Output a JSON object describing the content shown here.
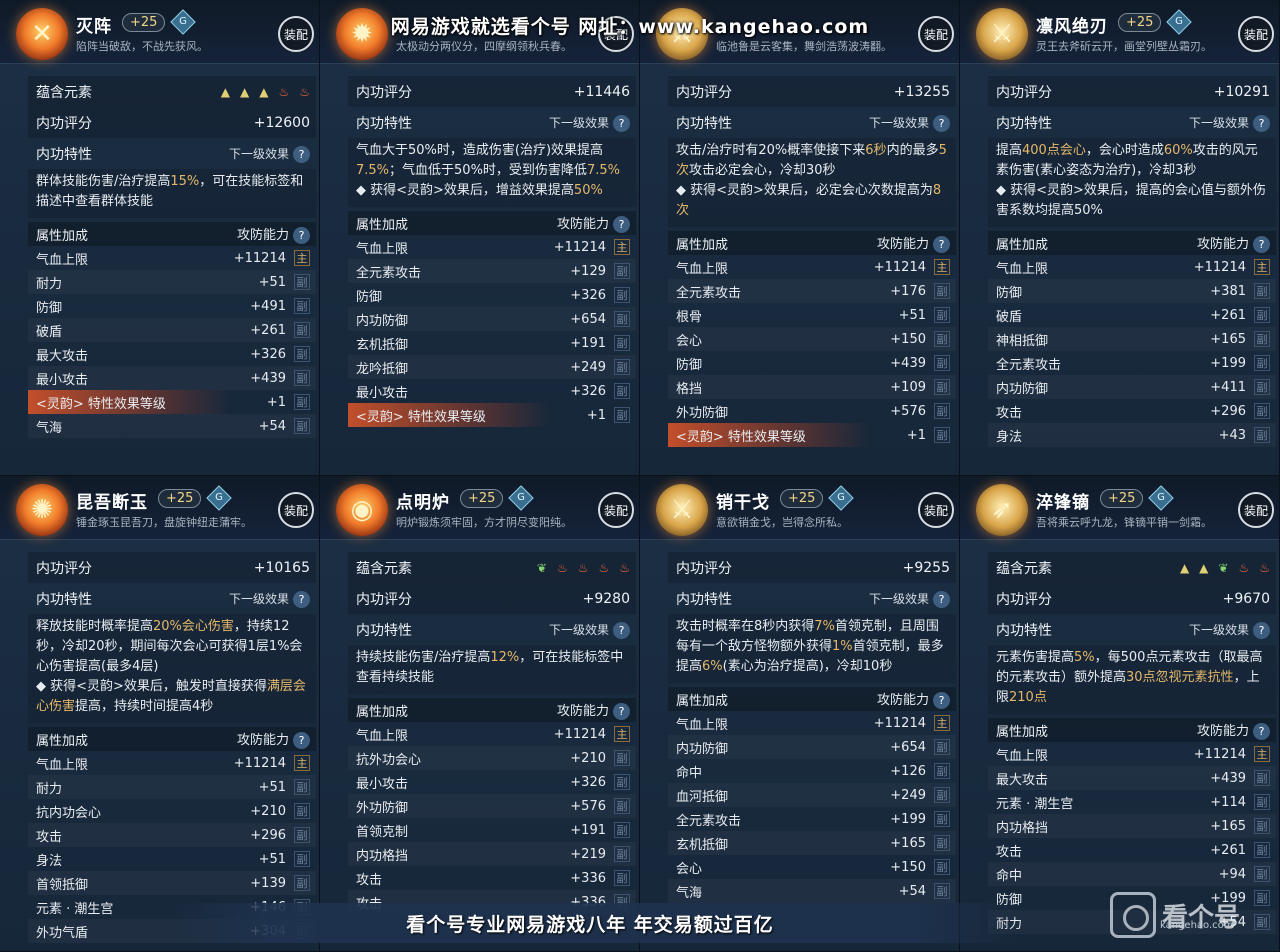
{
  "banner": "网易游戏就选看个号   网址：www.kangehao.com",
  "footer": "看个号专业网易游戏八年  年交易额过百亿",
  "watermark": {
    "brand": "看个号",
    "domain": "kangehao.com"
  },
  "common": {
    "equip": "装配",
    "next_effect": "下一级效果",
    "attr_header": "属性加成",
    "atk_def": "攻防能力",
    "q": "?",
    "main_tag": "主",
    "sub_tag": "副"
  },
  "cards": [
    {
      "name": "灭阵",
      "level": "+25",
      "grade": "G",
      "desc": "陷阵当破敌，不战先获风。",
      "icon": "flame-x-icon",
      "icon_style": "fire",
      "element_label": "蕴含元素",
      "elements": [
        {
          "kind": "earth",
          "glyph": "▲"
        },
        {
          "kind": "earth",
          "glyph": "▲"
        },
        {
          "kind": "earth",
          "glyph": "▲"
        },
        {
          "kind": "fire",
          "glyph": "♨"
        },
        {
          "kind": "fire",
          "glyph": "♨"
        }
      ],
      "score_label": "内功评分",
      "score": "+12600",
      "trait_label": "内功特性",
      "trait": [
        "群体技能伤害/治疗提高",
        "15%",
        "，可在技能标签和描述中查看群体技能"
      ],
      "attrs": [
        {
          "n": "气血上限",
          "v": "+11214",
          "t": "main"
        },
        {
          "n": "耐力",
          "v": "+51",
          "t": "sub"
        },
        {
          "n": "防御",
          "v": "+491",
          "t": "sub"
        },
        {
          "n": "破盾",
          "v": "+261",
          "t": "sub"
        },
        {
          "n": "最大攻击",
          "v": "+326",
          "t": "sub"
        },
        {
          "n": "最小攻击",
          "v": "+439",
          "t": "sub"
        },
        {
          "n": "<灵韵> 特性效果等级",
          "v": "+1",
          "t": "sub",
          "special": true
        },
        {
          "n": "气海",
          "v": "+54",
          "t": "sub"
        }
      ]
    },
    {
      "name": "",
      "level": "",
      "grade": "",
      "desc": "太极动分两仪分，四摩纲领秋兵春。",
      "icon": "flame-icon",
      "icon_style": "fire",
      "score_label": "内功评分",
      "score": "+11446",
      "trait_label": "内功特性",
      "trait": [
        "气血大于50%时，造成伤害(治疗)效果提高",
        "7.5%",
        "；气血低于50%时，受到伤害降低",
        "7.5%",
        "\n◆ 获得<灵韵>效果后，增益效果提高",
        "50%"
      ],
      "attrs": [
        {
          "n": "气血上限",
          "v": "+11214",
          "t": "main"
        },
        {
          "n": "全元素攻击",
          "v": "+129",
          "t": "sub"
        },
        {
          "n": "防御",
          "v": "+326",
          "t": "sub"
        },
        {
          "n": "内功防御",
          "v": "+654",
          "t": "sub"
        },
        {
          "n": "玄机抵御",
          "v": "+191",
          "t": "sub"
        },
        {
          "n": "龙吟抵御",
          "v": "+249",
          "t": "sub"
        },
        {
          "n": "最小攻击",
          "v": "+326",
          "t": "sub"
        },
        {
          "n": "<灵韵> 特性效果等级",
          "v": "+1",
          "t": "sub",
          "special": true
        }
      ]
    },
    {
      "name": "",
      "level": "",
      "grade": "",
      "desc": "临池鲁是云客集，舞剑浩荡波涛翻。",
      "icon": "blade-icon",
      "icon_style": "gold",
      "score_label": "内功评分",
      "score": "+13255",
      "trait_label": "内功特性",
      "trait": [
        "攻击/治疗时有20%概率使接下来",
        "6秒",
        "内的最多",
        "5次",
        "攻击必定会心，冷却30秒\n◆ 获得<灵韵>效果后，必定会心次数提高为",
        "8次"
      ],
      "attrs": [
        {
          "n": "气血上限",
          "v": "+11214",
          "t": "main"
        },
        {
          "n": "全元素攻击",
          "v": "+176",
          "t": "sub"
        },
        {
          "n": "根骨",
          "v": "+51",
          "t": "sub"
        },
        {
          "n": "会心",
          "v": "+150",
          "t": "sub"
        },
        {
          "n": "防御",
          "v": "+439",
          "t": "sub"
        },
        {
          "n": "格挡",
          "v": "+109",
          "t": "sub"
        },
        {
          "n": "外功防御",
          "v": "+576",
          "t": "sub"
        },
        {
          "n": "<灵韵> 特性效果等级",
          "v": "+1",
          "t": "sub",
          "special": true
        }
      ]
    },
    {
      "name": "凛风绝刃",
      "level": "+25",
      "grade": "G",
      "desc": "灵王去斧斫云开，画堂列壁丛霜刃。",
      "icon": "wind-blade-icon",
      "icon_style": "gold",
      "score_label": "内功评分",
      "score": "+10291",
      "trait_label": "内功特性",
      "trait": [
        "提高",
        "400点会心",
        "，会心时造成",
        "60%",
        "攻击的风元素伤害(素心姿态为治疗)，冷却3秒\n◆ 获得<灵韵>效果后，提高的会心值与额外伤害系数均提高50%"
      ],
      "attrs": [
        {
          "n": "气血上限",
          "v": "+11214",
          "t": "main"
        },
        {
          "n": "防御",
          "v": "+381",
          "t": "sub"
        },
        {
          "n": "破盾",
          "v": "+261",
          "t": "sub"
        },
        {
          "n": "神相抵御",
          "v": "+165",
          "t": "sub"
        },
        {
          "n": "全元素攻击",
          "v": "+199",
          "t": "sub"
        },
        {
          "n": "内功防御",
          "v": "+411",
          "t": "sub"
        },
        {
          "n": "攻击",
          "v": "+296",
          "t": "sub"
        },
        {
          "n": "身法",
          "v": "+43",
          "t": "sub"
        }
      ]
    },
    {
      "name": "昆吾断玉",
      "level": "+25",
      "grade": "G",
      "desc": "锤金琢玉昆吾刀，盘旋钟纽走蒲牢。",
      "icon": "flame-feather-icon",
      "icon_style": "fire",
      "score_label": "内功评分",
      "score": "+10165",
      "trait_label": "内功特性",
      "trait": [
        "释放技能时概率提高",
        "20%会心伤害",
        "，持续12秒，冷却20秒，期间每次会心可获得1层1%会心伤害提高(最多4层)\n◆ 获得<灵韵>效果后，触发时直接获得",
        "满层会心伤害",
        "提高，持续时间提高4秒"
      ],
      "attrs": [
        {
          "n": "气血上限",
          "v": "+11214",
          "t": "main"
        },
        {
          "n": "耐力",
          "v": "+51",
          "t": "sub"
        },
        {
          "n": "抗内功会心",
          "v": "+210",
          "t": "sub"
        },
        {
          "n": "攻击",
          "v": "+296",
          "t": "sub"
        },
        {
          "n": "身法",
          "v": "+51",
          "t": "sub"
        },
        {
          "n": "首领抵御",
          "v": "+139",
          "t": "sub"
        },
        {
          "n": "元素 · 潮生宫",
          "v": "+146",
          "t": "sub"
        },
        {
          "n": "外功气盾",
          "v": "+304",
          "t": "sub"
        }
      ]
    },
    {
      "name": "点明炉",
      "level": "+25",
      "grade": "G",
      "desc": "明炉锻炼须牢固，方才阴尽变阳纯。",
      "icon": "fire-ring-icon",
      "icon_style": "fire",
      "element_label": "蕴含元素",
      "elements": [
        {
          "kind": "wood",
          "glyph": "❦"
        },
        {
          "kind": "fire",
          "glyph": "♨"
        },
        {
          "kind": "fire",
          "glyph": "♨"
        },
        {
          "kind": "fire",
          "glyph": "♨"
        },
        {
          "kind": "fire",
          "glyph": "♨"
        }
      ],
      "score_label": "内功评分",
      "score": "+9280",
      "trait_label": "内功特性",
      "trait": [
        "持续技能伤害/治疗提高",
        "12%",
        "，可在技能标签中查看持续技能"
      ],
      "attrs": [
        {
          "n": "气血上限",
          "v": "+11214",
          "t": "main"
        },
        {
          "n": "抗外功会心",
          "v": "+210",
          "t": "sub"
        },
        {
          "n": "最小攻击",
          "v": "+326",
          "t": "sub"
        },
        {
          "n": "外功防御",
          "v": "+576",
          "t": "sub"
        },
        {
          "n": "首领克制",
          "v": "+191",
          "t": "sub"
        },
        {
          "n": "内功格挡",
          "v": "+219",
          "t": "sub"
        },
        {
          "n": "攻击",
          "v": "+336",
          "t": "sub"
        },
        {
          "n": "攻击",
          "v": "+336",
          "t": "sub"
        }
      ]
    },
    {
      "name": "销干戈",
      "level": "+25",
      "grade": "G",
      "desc": "意欲销金戈，岂得念所私。",
      "icon": "gold-blade-icon",
      "icon_style": "gold",
      "score_label": "内功评分",
      "score": "+9255",
      "trait_label": "内功特性",
      "trait": [
        "攻击时概率在8秒内获得",
        "7%",
        "首领克制，且周围每有一个敌方怪物额外获得",
        "1%",
        "首领克制，最多提高",
        "6%",
        "(素心为治疗提高)，冷却10秒"
      ],
      "attrs": [
        {
          "n": "气血上限",
          "v": "+11214",
          "t": "main"
        },
        {
          "n": "内功防御",
          "v": "+654",
          "t": "sub"
        },
        {
          "n": "命中",
          "v": "+126",
          "t": "sub"
        },
        {
          "n": "血河抵御",
          "v": "+249",
          "t": "sub"
        },
        {
          "n": "全元素攻击",
          "v": "+199",
          "t": "sub"
        },
        {
          "n": "玄机抵御",
          "v": "+165",
          "t": "sub"
        },
        {
          "n": "会心",
          "v": "+150",
          "t": "sub"
        },
        {
          "n": "气海",
          "v": "+54",
          "t": "sub"
        }
      ]
    },
    {
      "name": "淬锋镝",
      "level": "+25",
      "grade": "G",
      "desc": "吾将乘云呼九龙，锋镝平销一剑霜。",
      "icon": "arrow-icon",
      "icon_style": "gold",
      "element_label": "蕴含元素",
      "elements": [
        {
          "kind": "earth",
          "glyph": "▲"
        },
        {
          "kind": "earth",
          "glyph": "▲"
        },
        {
          "kind": "wood",
          "glyph": "❦"
        },
        {
          "kind": "fire",
          "glyph": "♨"
        },
        {
          "kind": "fire",
          "glyph": "♨"
        }
      ],
      "score_label": "内功评分",
      "score": "+9670",
      "trait_label": "内功特性",
      "trait": [
        "元素伤害提高",
        "5%",
        "，每500点元素攻击（取最高的元素攻击）额外提高",
        "30点忽视元素抗性",
        "，上限",
        "210点"
      ],
      "attrs": [
        {
          "n": "气血上限",
          "v": "+11214",
          "t": "main"
        },
        {
          "n": "最大攻击",
          "v": "+439",
          "t": "sub"
        },
        {
          "n": "元素 · 潮生宫",
          "v": "+114",
          "t": "sub"
        },
        {
          "n": "内功格挡",
          "v": "+165",
          "t": "sub"
        },
        {
          "n": "攻击",
          "v": "+261",
          "t": "sub"
        },
        {
          "n": "命中",
          "v": "+94",
          "t": "sub"
        },
        {
          "n": "防御",
          "v": "+199",
          "t": "sub"
        },
        {
          "n": "耐力",
          "v": "+54",
          "t": "sub"
        }
      ]
    }
  ]
}
